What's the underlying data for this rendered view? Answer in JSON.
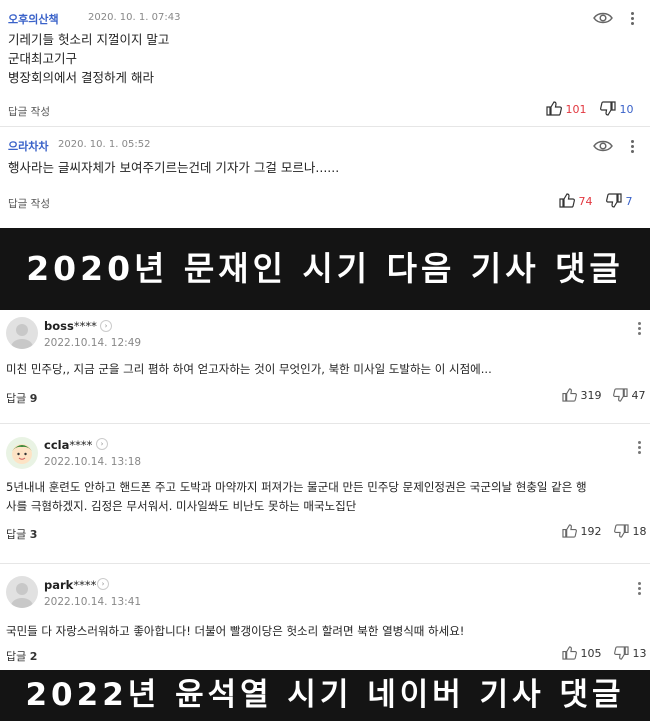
{
  "top_comments": [
    {
      "nickname": "오후의산책",
      "date": "2020. 10. 1. 07:43",
      "lines": [
        "기레기들  헛소리 지껄이지 말고",
        "군대최고기구",
        "병장회의에서  결정하게 해라"
      ],
      "reply_label": "답글 작성",
      "likes": "101",
      "dislikes": "10"
    },
    {
      "nickname": "으라차차",
      "date": "2020. 10. 1. 05:52",
      "lines": [
        "행사라는 글씨자체가 보여주기르는건데 기자가 그걸 모르나......"
      ],
      "reply_label": "답글 작성",
      "likes": "74",
      "dislikes": "7"
    }
  ],
  "banner_top": "2020년 문재인 시기 다음 기사 댓글",
  "bottom_comments": [
    {
      "nickname": "boss",
      "mask": "****",
      "date": "2022.10.14. 12:49",
      "lines": [
        "미친 민주당,, 지금 군을 그리 폄하 하여 얻고자하는 것이 무엇인가, 북한 미사일 도발하는 이 시점에..."
      ],
      "reply_label": "답글",
      "reply_count": "9",
      "likes": "319",
      "dislikes": "47"
    },
    {
      "nickname": "ccla",
      "mask": "****",
      "date": "2022.10.14. 13:18",
      "lines": [
        "5년내내 훈련도 안하고 핸드폰 주고 도박과 마약까지 퍼져가는 물군대 만든 민주당 문제인정권은 국군의날 현충일 같은 행",
        "사를 극혐하겠지. 김정은 무서워서. 미사일쏴도 비난도 못하는 매국노집단"
      ],
      "reply_label": "답글",
      "reply_count": "3",
      "likes": "192",
      "dislikes": "18"
    },
    {
      "nickname": "park",
      "mask": "****",
      "date": "2022.10.14. 13:41",
      "lines": [
        "국민들 다 자랑스러워하고 좋아합니다! 더불어 빨갱이당은 헛소리 할려면 북한 열병식때 하세요!"
      ],
      "reply_label": "답글",
      "reply_count": "2",
      "likes": "105",
      "dislikes": "13"
    }
  ],
  "banner_bottom": "2022년 윤석열 시기 네이버 기사 댓글",
  "colors": {
    "nickname_blue": "#3a62c9",
    "like_red": "#e2373f",
    "banner_bg": "#141414"
  }
}
